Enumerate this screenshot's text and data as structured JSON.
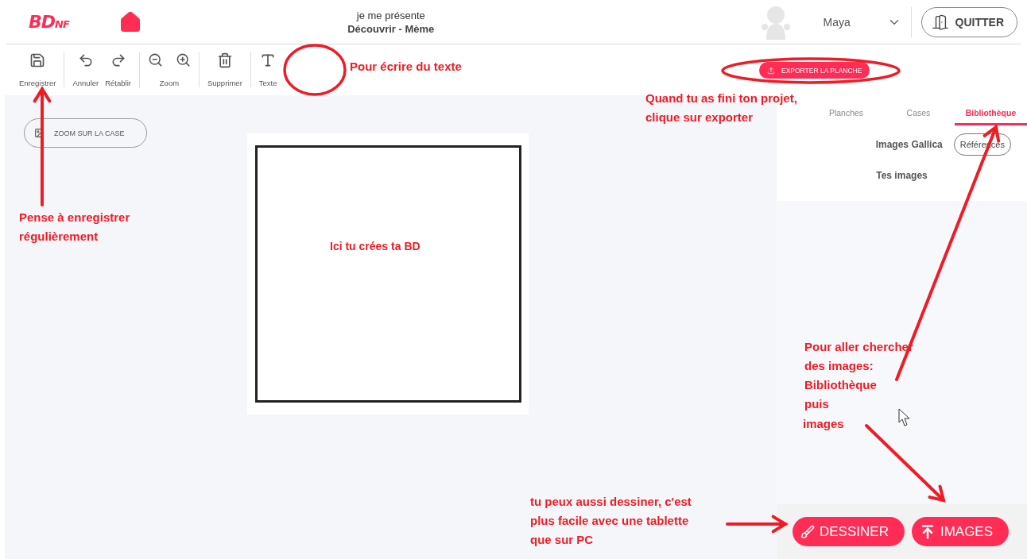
{
  "header": {
    "logo": "BDNF",
    "title": "je me présente",
    "subtitle": "Découvrir - Mème",
    "user": "Maya",
    "quit": "QUITTER"
  },
  "toolbar": {
    "groups": [
      {
        "items": [
          {
            "kind": "button",
            "label": "Enregistrer"
          }
        ]
      },
      {
        "items": [
          {
            "kind": "button",
            "label": "Annuler"
          },
          {
            "kind": "button",
            "label": "Rétablir"
          }
        ]
      },
      {
        "items": [
          {
            "kind": "zoom",
            "label": "Zoom"
          }
        ]
      },
      {
        "items": [
          {
            "kind": "button",
            "label": "Supprimer"
          }
        ]
      },
      {
        "items": [
          {
            "kind": "button",
            "label": "Texte"
          }
        ]
      }
    ],
    "export": "EXPORTER LA PLANCHE"
  },
  "canvas": {
    "zoom_button": "ZOOM SUR LA CASE"
  },
  "panel": {
    "tabs": [
      {
        "label": "Planches",
        "selected": false
      },
      {
        "label": "Cases",
        "selected": false
      },
      {
        "label": "Bibliothèque",
        "selected": true
      }
    ],
    "gallica": "Images Gallica",
    "references": "Références",
    "own_images": "Tes images",
    "draw_button": "DESSINER",
    "images_button": "IMAGES"
  },
  "annotations": [
    {
      "kind": "text",
      "lines": [
        "Pour écrire du texte"
      ]
    },
    {
      "kind": "text",
      "lines": [
        "Quand tu as fini ton projet,",
        "clique sur exporter"
      ]
    },
    {
      "kind": "text",
      "lines": [
        "Pense à enregistrer",
        "régulièrement"
      ]
    },
    {
      "kind": "small",
      "lines": [
        "Ici tu crées ta BD"
      ]
    },
    {
      "kind": "text",
      "lines": [
        "Pour aller chercher",
        "des images:",
        "Bibliothèque",
        "puis"
      ]
    },
    {
      "kind": "text",
      "lines": [
        "images"
      ]
    },
    {
      "kind": "text",
      "lines": [
        "tu peux aussi dessiner, c'est",
        "plus facile avec une tablette",
        "que sur PC"
      ]
    }
  ]
}
